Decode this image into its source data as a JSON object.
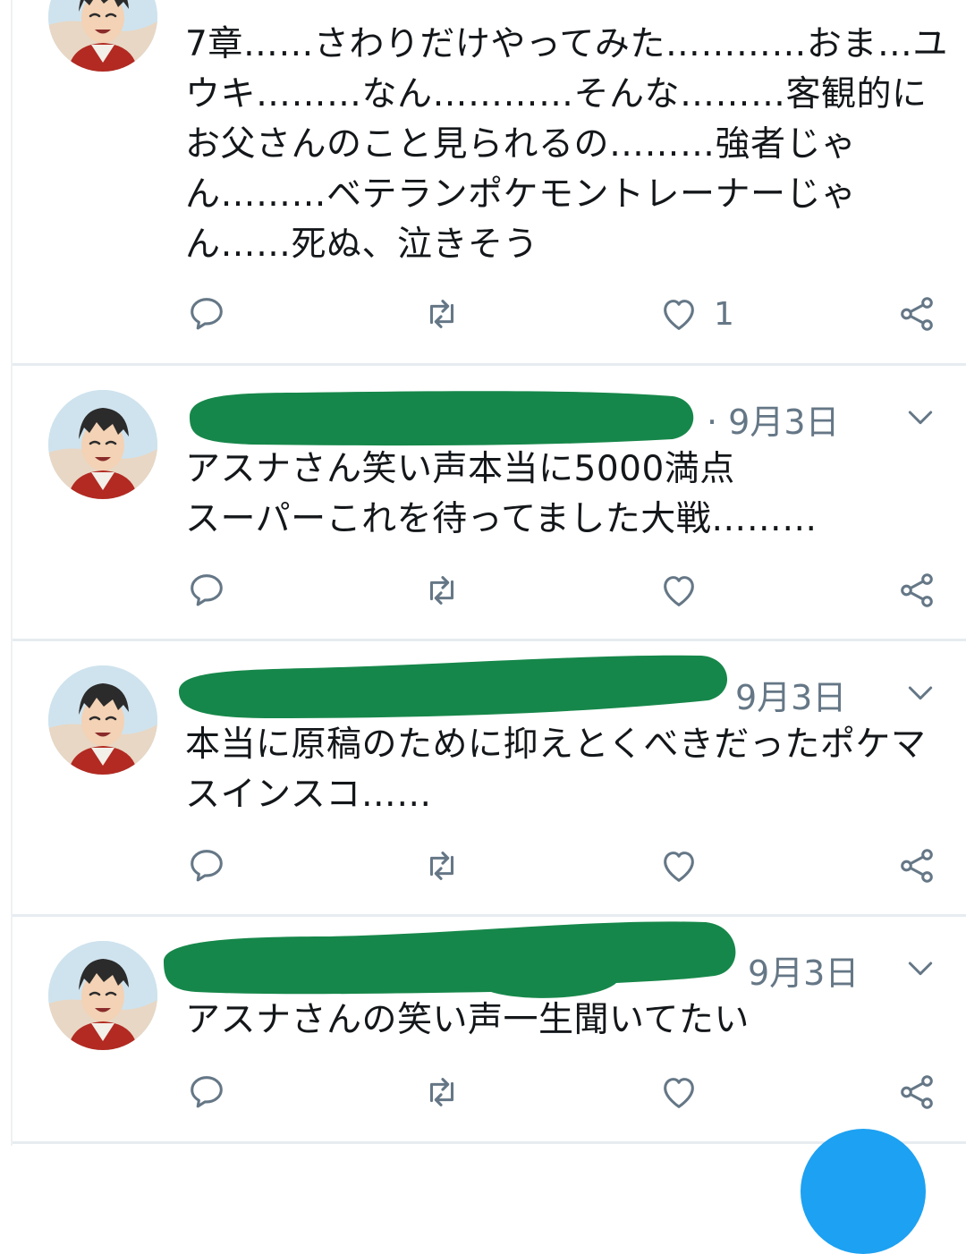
{
  "colors": {
    "accent": "#1da1f2",
    "icon": "#657786",
    "redaction": "#16874a",
    "divider": "#e6ecf0"
  },
  "tweets": [
    {
      "header_partial": "",
      "time": "",
      "text": "7章……さわりだけやってみた…………おま…ユウキ………なん…………そんな………客観的にお父さんのこと見られるの………強者じゃん………ベテランポケモントレーナーじゃん……死ぬ、泣きそう",
      "actions": {
        "reply_icon": "reply-icon",
        "retweet_icon": "retweet-icon",
        "like_icon": "heart-icon",
        "like_count": "1",
        "share_icon": "share-icon"
      }
    },
    {
      "time": "· 9月3日",
      "text": "アスナさん笑い声本当に5000満点\nスーパーこれを待ってました大戦………",
      "actions": {
        "reply_icon": "reply-icon",
        "retweet_icon": "retweet-icon",
        "like_icon": "heart-icon",
        "like_count": "",
        "share_icon": "share-icon"
      }
    },
    {
      "time": "9月3日",
      "text": "本当に原稿のために抑えとくべきだったポケマスインスコ……",
      "actions": {
        "reply_icon": "reply-icon",
        "retweet_icon": "retweet-icon",
        "like_icon": "heart-icon",
        "like_count": "",
        "share_icon": "share-icon"
      }
    },
    {
      "time": "9月3日",
      "text": "アスナさんの笑い声一生聞いてたい",
      "actions": {
        "reply_icon": "reply-icon",
        "retweet_icon": "retweet-icon",
        "like_icon": "heart-icon",
        "like_count": "",
        "share_icon": "share-icon"
      }
    }
  ]
}
